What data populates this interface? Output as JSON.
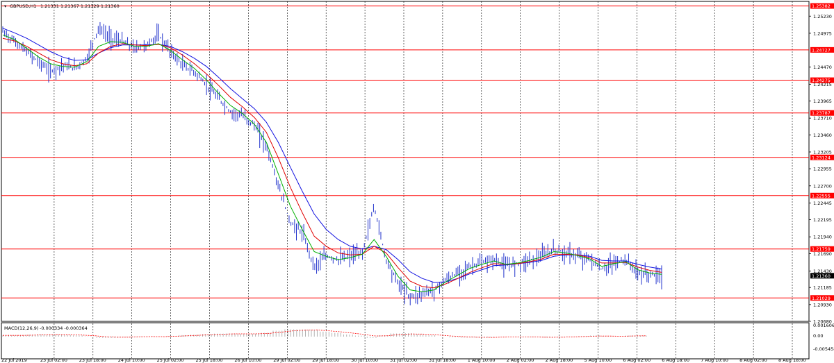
{
  "header": {
    "symbol": "GBPUSD,H1",
    "ohlc": "1.21331 1.21367 1.21329 1.21360"
  },
  "macd": {
    "label": "MACD(12,26,9)",
    "values": "-0.000334 -0.000364"
  },
  "colors": {
    "candle": "#2233cc",
    "ma_fast": "#00b000",
    "ma_mid": "#e00000",
    "ma_slow": "#1010e0",
    "level": "#ff0000",
    "current_price_box": "#000000",
    "macd_hist": "#b0b0b0",
    "macd_signal": "#ff0000"
  },
  "chart_data": {
    "type": "line",
    "symbol": "GBPUSD",
    "timeframe": "H1",
    "ylim": [
      1.2068,
      1.2545
    ],
    "y_ticks": [
      "1.25230",
      "1.24975",
      "1.24470",
      "1.24215",
      "1.23965",
      "1.23710",
      "1.23460",
      "1.23205",
      "1.22955",
      "1.22700",
      "1.22445",
      "1.22195",
      "1.21940",
      "1.21690",
      "1.21430",
      "1.21185",
      "1.20930",
      "1.20680"
    ],
    "x_ticks": [
      "22 Jul 2019",
      "23 Jul 02:00",
      "23 Jul 18:00",
      "24 Jul 10:00",
      "25 Jul 02:00",
      "25 Jul 18:00",
      "26 Jul 10:00",
      "29 Jul 02:00",
      "29 Jul 18:00",
      "30 Jul 10:00",
      "31 Jul 02:00",
      "31 Jul 18:00",
      "1 Aug 10:00",
      "2 Aug 02:00",
      "2 Aug 18:00",
      "5 Aug 10:00",
      "6 Aug 02:00",
      "6 Aug 18:00",
      "7 Aug 10:00",
      "8 Aug 02:00",
      "8 Aug 18:00"
    ],
    "levels": [
      "1.25382",
      "1.24727",
      "1.24275",
      "1.23787",
      "1.23124",
      "1.22555",
      "1.21759",
      "1.21029"
    ],
    "current_price": "1.21360",
    "price_x": [
      0,
      4,
      8,
      12,
      16,
      20,
      24,
      28,
      32,
      36,
      40,
      44,
      48,
      52,
      56,
      60,
      64,
      68,
      72,
      76,
      80,
      84,
      88,
      92,
      96,
      100,
      104,
      108,
      112,
      116,
      120,
      124,
      128,
      132,
      136,
      140,
      144,
      148,
      152,
      156,
      160,
      164,
      168,
      172,
      176,
      180,
      184,
      188,
      192,
      196,
      200,
      204,
      208,
      212,
      216,
      220
    ],
    "price": [
      1.25,
      1.2485,
      1.247,
      1.2455,
      1.244,
      1.245,
      1.2445,
      1.246,
      1.2505,
      1.249,
      1.2485,
      1.2475,
      1.248,
      1.2495,
      1.247,
      1.245,
      1.244,
      1.242,
      1.24,
      1.238,
      1.2375,
      1.236,
      1.233,
      1.227,
      1.2215,
      1.22,
      1.215,
      1.2165,
      1.216,
      1.2165,
      1.217,
      1.224,
      1.216,
      1.2125,
      1.2105,
      1.211,
      1.2115,
      1.213,
      1.214,
      1.215,
      1.2155,
      1.216,
      1.215,
      1.2155,
      1.216,
      1.2165,
      1.2175,
      1.217,
      1.2165,
      1.216,
      1.2145,
      1.2155,
      1.216,
      1.214,
      1.2138,
      1.2136
    ],
    "ma_fast": [
      1.2495,
      1.2488,
      1.2475,
      1.2462,
      1.2452,
      1.2448,
      1.2447,
      1.2455,
      1.2478,
      1.2485,
      1.2484,
      1.2478,
      1.2478,
      1.2482,
      1.2472,
      1.2458,
      1.2445,
      1.2428,
      1.2408,
      1.239,
      1.2378,
      1.2362,
      1.2335,
      1.2288,
      1.224,
      1.2205,
      1.2172,
      1.2165,
      1.216,
      1.2163,
      1.2168,
      1.219,
      1.2165,
      1.2135,
      1.2115,
      1.2112,
      1.2115,
      1.2127,
      1.2137,
      1.2147,
      1.2153,
      1.2158,
      1.2153,
      1.2155,
      1.2159,
      1.2164,
      1.2172,
      1.217,
      1.2166,
      1.2161,
      1.215,
      1.2154,
      1.2157,
      1.2145,
      1.214,
      1.2138
    ],
    "ma_mid": [
      1.249,
      1.2486,
      1.2478,
      1.2468,
      1.2458,
      1.2452,
      1.2449,
      1.2452,
      1.2468,
      1.2478,
      1.2482,
      1.248,
      1.2479,
      1.2481,
      1.2476,
      1.2465,
      1.2452,
      1.2437,
      1.242,
      1.2402,
      1.2388,
      1.2372,
      1.235,
      1.2312,
      1.2268,
      1.223,
      1.2195,
      1.218,
      1.217,
      1.2167,
      1.2168,
      1.218,
      1.217,
      1.2148,
      1.2128,
      1.212,
      1.2118,
      1.2124,
      1.2132,
      1.2141,
      1.2148,
      1.2154,
      1.2153,
      1.2154,
      1.2157,
      1.2161,
      1.2168,
      1.2168,
      1.2167,
      1.2163,
      1.2155,
      1.2155,
      1.2156,
      1.2149,
      1.2144,
      1.2141
    ],
    "ma_slow": [
      1.2505,
      1.2498,
      1.249,
      1.248,
      1.247,
      1.2462,
      1.2457,
      1.2458,
      1.2468,
      1.2476,
      1.248,
      1.248,
      1.248,
      1.2481,
      1.2478,
      1.247,
      1.246,
      1.2448,
      1.2432,
      1.2415,
      1.24,
      1.2385,
      1.2365,
      1.2335,
      1.2298,
      1.2262,
      1.2228,
      1.2205,
      1.219,
      1.218,
      1.2176,
      1.218,
      1.2175,
      1.216,
      1.2142,
      1.2132,
      1.2126,
      1.2127,
      1.2132,
      1.2139,
      1.2145,
      1.2151,
      1.2152,
      1.2154,
      1.2156,
      1.2159,
      1.2165,
      1.2167,
      1.2167,
      1.2165,
      1.2159,
      1.2158,
      1.2158,
      1.2153,
      1.2149,
      1.2146
    ]
  }
}
